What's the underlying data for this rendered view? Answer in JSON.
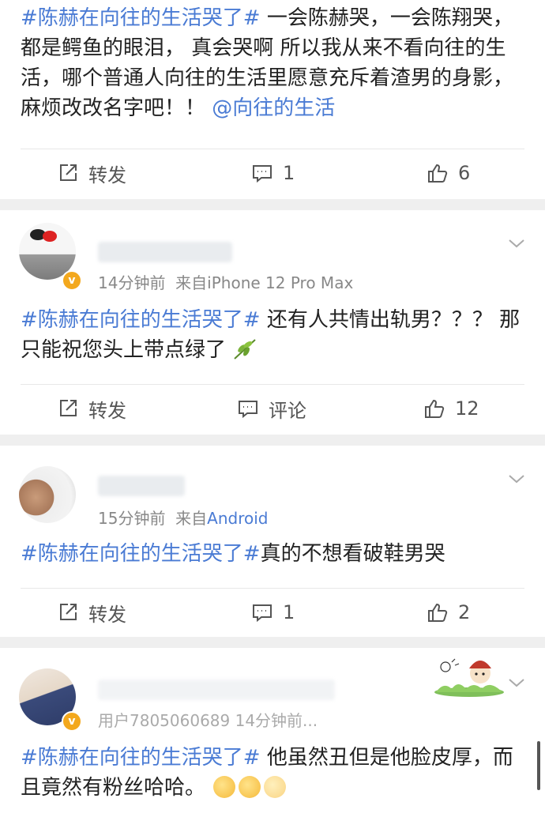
{
  "posts": [
    {
      "topic": "#陈赫在向往的生活哭了#",
      "body": " 一会陈赫哭，一会陈翔哭，都是鳄鱼的眼泪，  真会哭啊 所以我从来不看向往的生活，哪个普通人向往的生活里愿意充斥着渣男的身影，麻烦改改名字吧！！ ",
      "mention": "@向往的生活",
      "repost_label": "转发",
      "comment_label": "1",
      "like_count": "6"
    },
    {
      "time": "14分钟前",
      "source_prefix": "来自",
      "source": "iPhone 12 Pro Max",
      "topic": "#陈赫在向往的生活哭了#",
      "body": " 还有人共情出轨男？？？ 那只能祝您头上带点绿了",
      "repost_label": "转发",
      "comment_label": "评论",
      "like_count": "12"
    },
    {
      "time": "15分钟前",
      "source_prefix": "来自",
      "source": "Android",
      "topic": "#陈赫在向往的生活哭了#",
      "body": "真的不想看破鞋男哭",
      "repost_label": "转发",
      "comment_label": "1",
      "like_count": "2"
    },
    {
      "meta_text": "用户7805060689  14分钟前...",
      "topic": "#陈赫在向往的生活哭了#",
      "body": " 他虽然丑但是他脸皮厚，而且竟然有粉丝哈哈。"
    }
  ],
  "colors": {
    "link": "#4a7bd4",
    "badge": "#f3a81d",
    "background": "#efefef"
  },
  "icons": [
    "repost-icon",
    "comment-icon",
    "like-icon",
    "chevron-down-icon",
    "leaf-emoji",
    "laugh-emoji"
  ]
}
